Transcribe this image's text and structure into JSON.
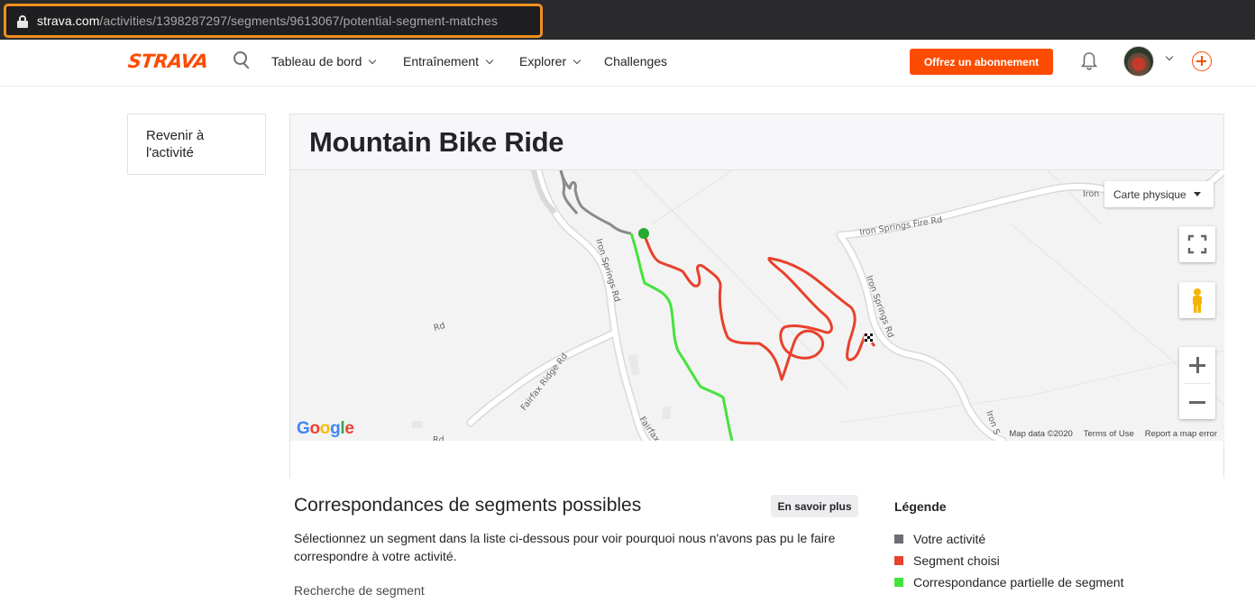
{
  "browser": {
    "url_host": "strava.com",
    "url_path": "/activities/1398287297/segments/9613067/potential-segment-matches"
  },
  "nav": {
    "logo": "STRAVA",
    "items": [
      {
        "label": "Tableau de bord",
        "has_dropdown": true
      },
      {
        "label": "Entraînement",
        "has_dropdown": true
      },
      {
        "label": "Explorer",
        "has_dropdown": true
      },
      {
        "label": "Challenges",
        "has_dropdown": false
      }
    ],
    "subscribe_label": "Offrez un abonnement",
    "accent": "#fc4c02"
  },
  "sidebar": {
    "back_label": "Revenir à l'activité"
  },
  "main": {
    "title": "Mountain Bike Ride"
  },
  "map": {
    "type_label": "Carte physique",
    "road_labels": [
      "Iron Springs Fire Rd",
      "Iron Springs Rd",
      "Iron Springs Rd",
      "Fairfax Ridge Rd",
      "Fairfax Ridge Rd",
      "Iron",
      "Iron S",
      "Rd",
      "Rd"
    ],
    "attribution": {
      "map_data": "Map data ©2020",
      "terms": "Terms of Use",
      "report": "Report a map error"
    },
    "google_logo": [
      "G",
      "o",
      "o",
      "g",
      "l",
      "e"
    ]
  },
  "matches": {
    "title": "Correspondances de segments possibles",
    "learn_more_label": "En savoir plus",
    "description": "Sélectionnez un segment dans la liste ci-dessous pour voir pourquoi nous n'avons pas pu le faire correspondre à votre activité.",
    "search_label": "Recherche de segment"
  },
  "legend": {
    "title": "Légende",
    "items": [
      {
        "label": "Votre activité",
        "color": "#6d6d78"
      },
      {
        "label": "Segment choisi",
        "color": "#e8412c"
      },
      {
        "label": "Correspondance partielle de segment",
        "color": "#44e33c"
      }
    ]
  }
}
